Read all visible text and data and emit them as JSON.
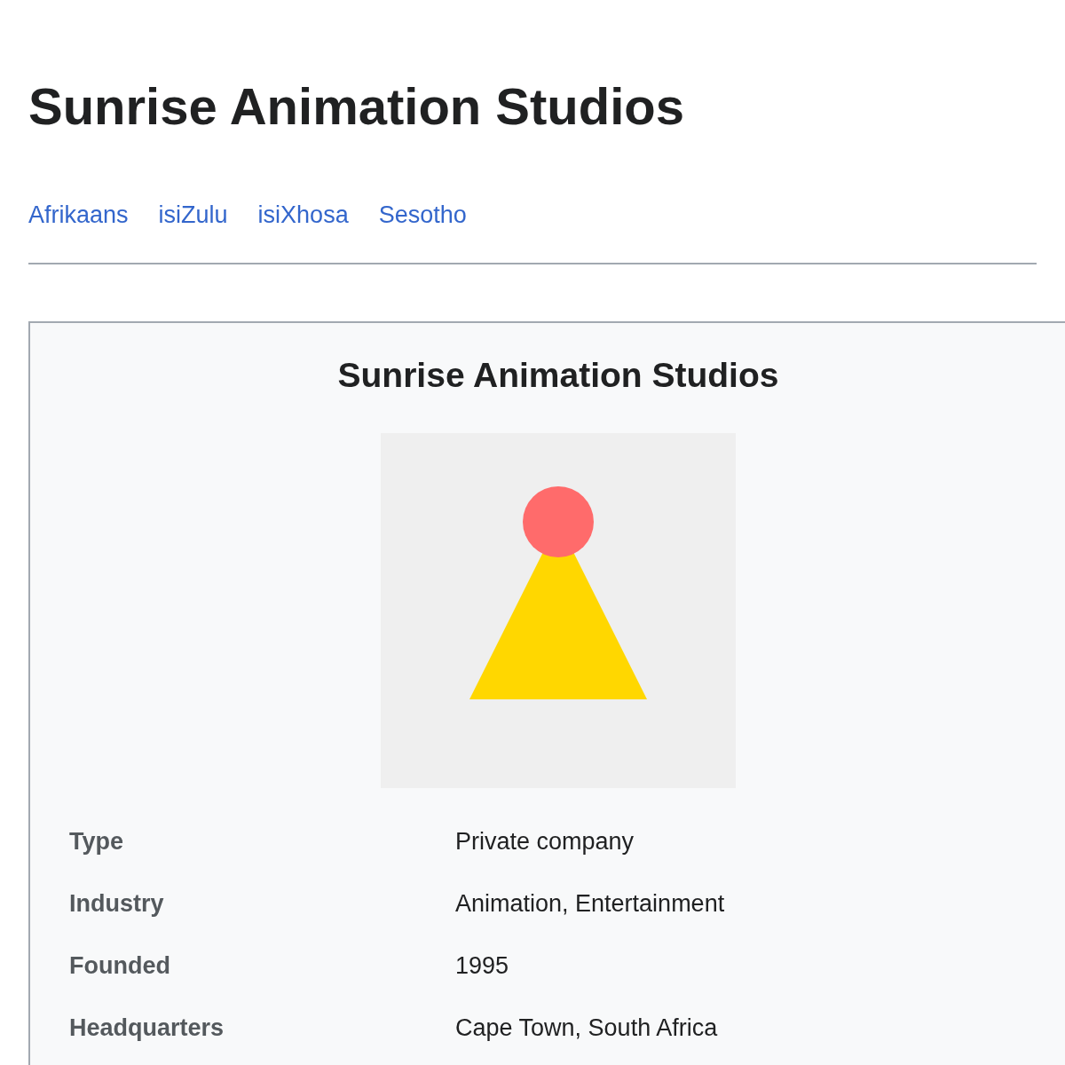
{
  "page_title": "Sunrise Animation Studios",
  "languages": [
    {
      "label": "Afrikaans"
    },
    {
      "label": "isiZulu"
    },
    {
      "label": "isiXhosa"
    },
    {
      "label": "Sesotho"
    }
  ],
  "infobox": {
    "title": "Sunrise Animation Studios",
    "rows": [
      {
        "label": "Type",
        "value": "Private company"
      },
      {
        "label": "Industry",
        "value": "Animation, Entertainment"
      },
      {
        "label": "Founded",
        "value": "1995"
      },
      {
        "label": "Headquarters",
        "value": "Cape Town, South Africa"
      }
    ]
  }
}
